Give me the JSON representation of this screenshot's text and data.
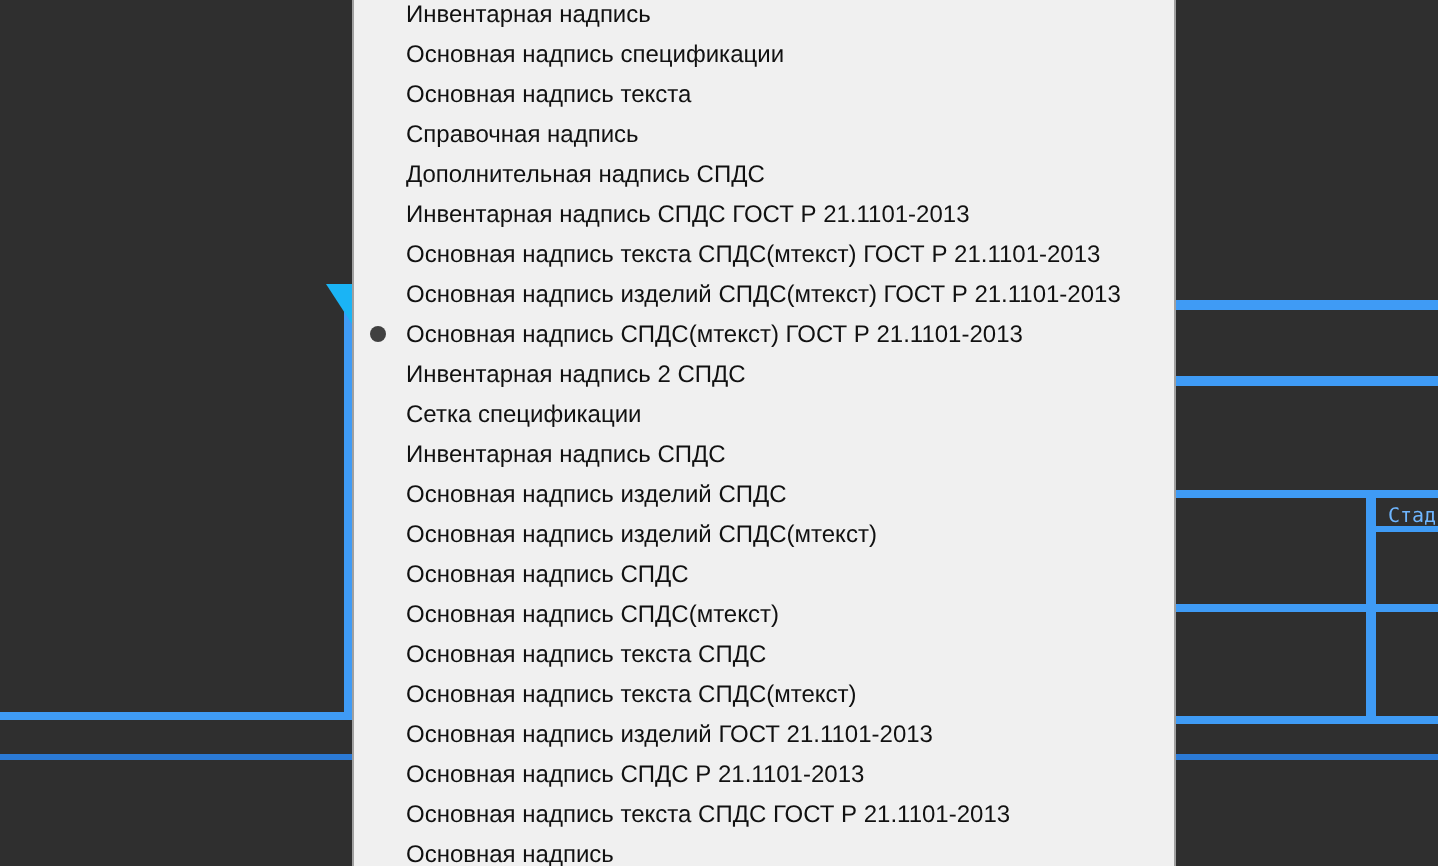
{
  "drawing": {
    "label": "Стад"
  },
  "menu": {
    "items": [
      {
        "label": "Инвентарная надпись",
        "selected": false
      },
      {
        "label": "Основная надпись спецификации",
        "selected": false
      },
      {
        "label": "Основная надпись текста",
        "selected": false
      },
      {
        "label": "Справочная надпись",
        "selected": false
      },
      {
        "label": "Дополнительная надпись СПДС",
        "selected": false
      },
      {
        "label": "Инвентарная надпись СПДС ГОСТ Р 21.1101-2013",
        "selected": false
      },
      {
        "label": "Основная надпись текста СПДС(мтекст) ГОСТ Р 21.1101-2013",
        "selected": false
      },
      {
        "label": "Основная надпись изделий СПДС(мтекст) ГОСТ Р 21.1101-2013",
        "selected": false
      },
      {
        "label": "Основная надпись СПДС(мтекст) ГОСТ Р 21.1101-2013",
        "selected": true
      },
      {
        "label": "Инвентарная надпись 2 СПДС",
        "selected": false
      },
      {
        "label": "Сетка спецификации",
        "selected": false
      },
      {
        "label": "Инвентарная надпись СПДС",
        "selected": false
      },
      {
        "label": "Основная надпись изделий СПДС",
        "selected": false
      },
      {
        "label": "Основная надпись изделий СПДС(мтекст)",
        "selected": false
      },
      {
        "label": "Основная надпись СПДС",
        "selected": false
      },
      {
        "label": "Основная надпись СПДС(мтекст)",
        "selected": false
      },
      {
        "label": "Основная надпись текста СПДС",
        "selected": false
      },
      {
        "label": "Основная надпись текста СПДС(мтекст)",
        "selected": false
      },
      {
        "label": "Основная надпись изделий ГОСТ 21.1101-2013",
        "selected": false
      },
      {
        "label": "Основная надпись СПДС Р 21.1101-2013",
        "selected": false
      },
      {
        "label": "Основная надпись текста СПДС ГОСТ Р 21.1101-2013",
        "selected": false
      },
      {
        "label": "Основная надпись",
        "selected": false
      }
    ]
  }
}
